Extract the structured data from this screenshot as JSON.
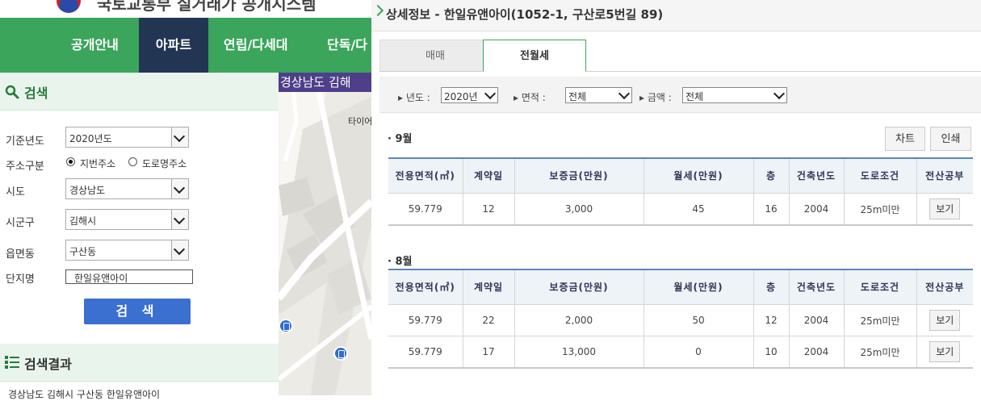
{
  "site": {
    "title": "국토교통부 실거래가 공개시스템"
  },
  "nav": {
    "items": [
      "공개안내",
      "아파트",
      "연립/다세대",
      "단독/다"
    ]
  },
  "search": {
    "section_title": "검색",
    "fields": {
      "year": {
        "label": "기준년도",
        "value": "2020년도"
      },
      "addr_type": {
        "label": "주소구분",
        "option1": "지번주소",
        "option2": "도로명주소"
      },
      "sido": {
        "label": "시도",
        "value": "경상남도"
      },
      "sigungu": {
        "label": "시군구",
        "value": "김해시"
      },
      "eupmyeon": {
        "label": "읍면동",
        "value": "구산동"
      },
      "danji": {
        "label": "단지명",
        "value": "한일유앤아이"
      }
    },
    "button": "검 색"
  },
  "results": {
    "section_title": "검색결과",
    "first_item": "경상남도 김해시 구산동 한일유앤아이"
  },
  "map": {
    "region": "경상남도 김해",
    "label": "타이어"
  },
  "detail": {
    "title": "상세정보 - 한일유앤아이(1052-1, 구산로5번길 89)",
    "tabs": [
      "매매",
      "전월세"
    ],
    "filters": {
      "year_label": "년도 :",
      "year_value": "2020년",
      "area_label": "면적 :",
      "area_value": "전체",
      "amount_label": "금액 :",
      "amount_value": "전체"
    },
    "buttons": {
      "chart": "차트",
      "print": "인쇄"
    },
    "columns": [
      "전용면적(㎡)",
      "계약일",
      "보증금(만원)",
      "월세(만원)",
      "층",
      "건축년도",
      "도로조건",
      "전산공부"
    ],
    "groups": [
      {
        "month": "9월",
        "rows": [
          [
            "59.779",
            "12",
            "3,000",
            "45",
            "16",
            "2004",
            "25m미만",
            "보기"
          ]
        ]
      },
      {
        "month": "8월",
        "rows": [
          [
            "59.779",
            "22",
            "2,000",
            "50",
            "12",
            "2004",
            "25m미만",
            "보기"
          ],
          [
            "59.779",
            "17",
            "13,000",
            "0",
            "10",
            "2004",
            "25m미만",
            "보기"
          ]
        ]
      }
    ]
  }
}
